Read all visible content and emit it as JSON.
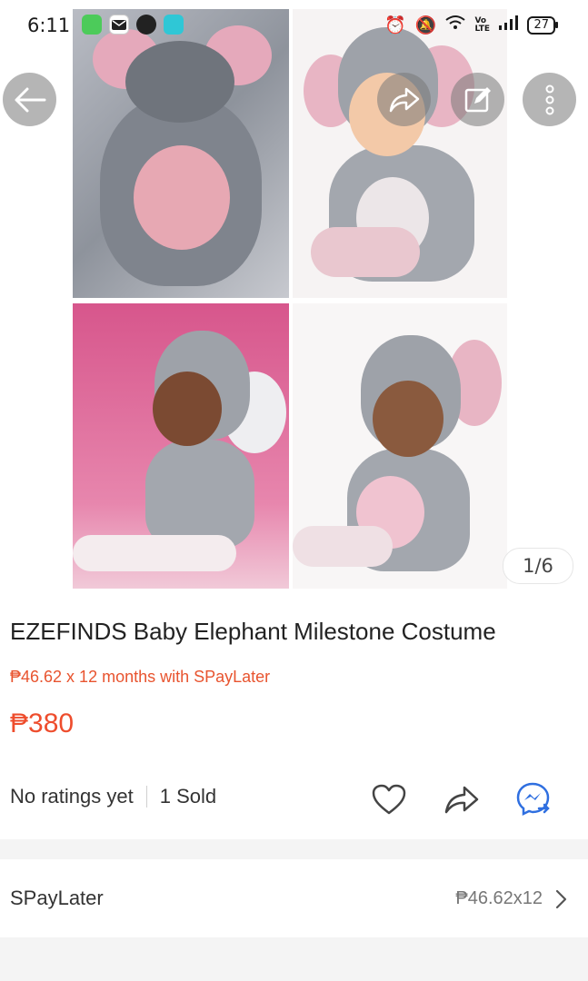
{
  "status_bar": {
    "time": "6:11",
    "battery": "27",
    "network": "Vo LTE"
  },
  "gallery": {
    "counter": "1/6",
    "current_image": 1,
    "total_images": 6
  },
  "product": {
    "title": "EZEFINDS Baby Elephant Milestone Costume",
    "installment_promo": "₱46.62 x 12 months with SPayLater",
    "price": "₱380",
    "ratings": "No ratings yet",
    "sold": "1 Sold"
  },
  "spaylater": {
    "label": "SPayLater",
    "value": "₱46.62x12"
  },
  "colors": {
    "accent": "#ee4d2d",
    "promo": "#e8542f",
    "chat_icon": "#2f6fe0"
  },
  "icons": {
    "back": "arrow-left-icon",
    "share": "share-arrow-icon",
    "edit": "edit-icon",
    "more": "more-vertical-icon",
    "like": "heart-icon",
    "chat": "messenger-icon",
    "chevron": "chevron-right-icon"
  }
}
